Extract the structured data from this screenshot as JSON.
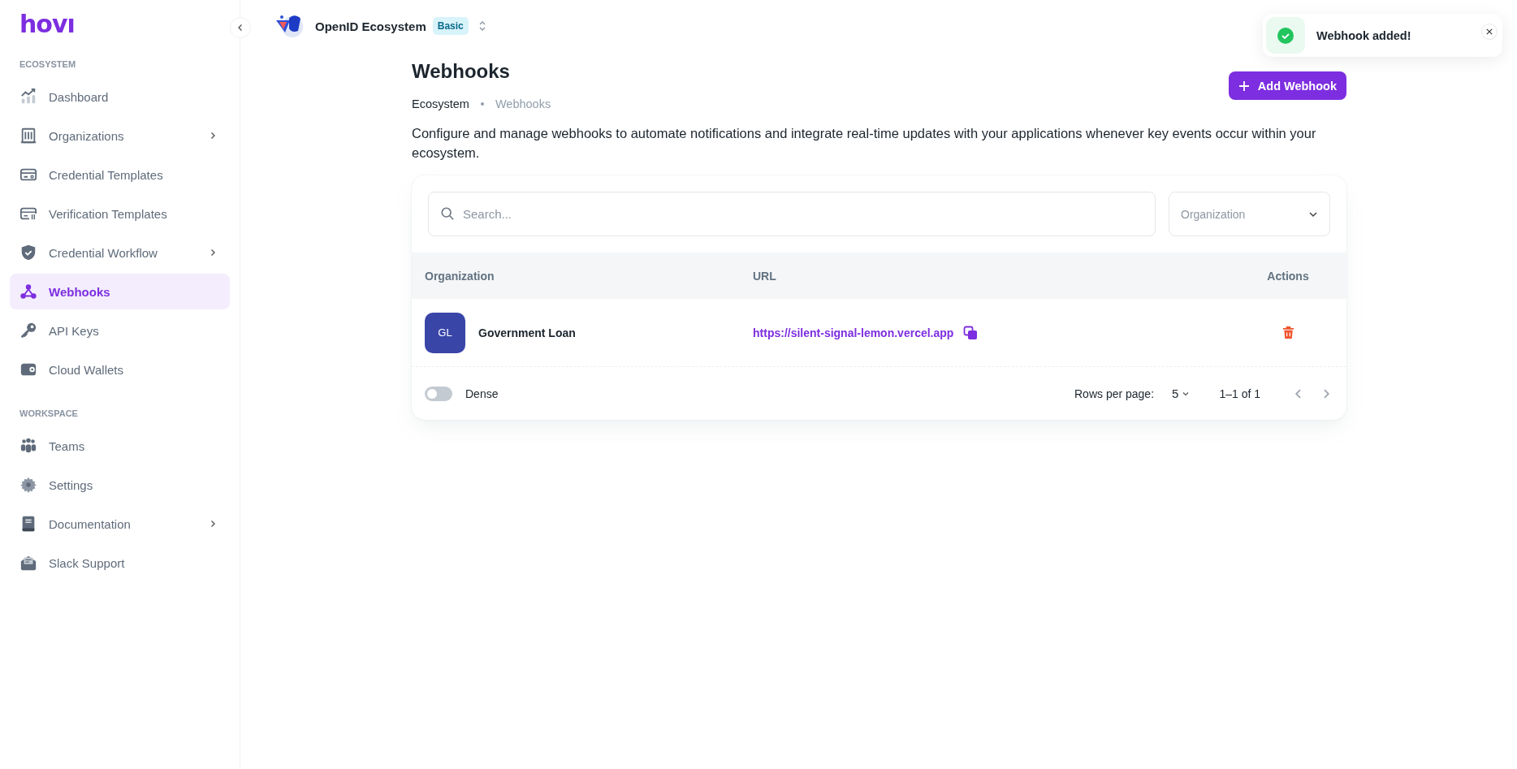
{
  "sidebar": {
    "logo": "hovı",
    "sections": [
      {
        "title": "ECOSYSTEM",
        "items": [
          {
            "label": "Dashboard",
            "selected": false,
            "has_submenu": false
          },
          {
            "label": "Organizations",
            "selected": false,
            "has_submenu": true
          },
          {
            "label": "Credential Templates",
            "selected": false,
            "has_submenu": false
          },
          {
            "label": "Verification Templates",
            "selected": false,
            "has_submenu": false
          },
          {
            "label": "Credential Workflow",
            "selected": false,
            "has_submenu": true
          },
          {
            "label": "Webhooks",
            "selected": true,
            "has_submenu": false
          },
          {
            "label": "API Keys",
            "selected": false,
            "has_submenu": false
          },
          {
            "label": "Cloud Wallets",
            "selected": false,
            "has_submenu": false
          }
        ]
      },
      {
        "title": "WORKSPACE",
        "items": [
          {
            "label": "Teams",
            "selected": false,
            "has_submenu": false
          },
          {
            "label": "Settings",
            "selected": false,
            "has_submenu": false
          },
          {
            "label": "Documentation",
            "selected": false,
            "has_submenu": true
          },
          {
            "label": "Slack Support",
            "selected": false,
            "has_submenu": false
          }
        ]
      }
    ]
  },
  "header": {
    "ecosystem": "OpenID Ecosystem",
    "plan_badge": "Basic"
  },
  "page": {
    "title": "Webhooks",
    "breadcrumbs": [
      "Ecosystem",
      "Webhooks"
    ],
    "description": "Configure and manage webhooks to automate notifications and integrate real-time updates with your applications whenever key events occur within your ecosystem.",
    "add_button": "Add Webhook"
  },
  "filters": {
    "search_placeholder": "Search...",
    "organization_placeholder": "Organization"
  },
  "table": {
    "columns": [
      "Organization",
      "URL",
      "Actions"
    ],
    "rows": [
      {
        "initials": "GL",
        "organization": "Government Loan",
        "url": "https://silent-signal-lemon.vercel.app"
      }
    ]
  },
  "footer": {
    "dense_label": "Dense",
    "dense": false,
    "rows_per_page_label": "Rows per page:",
    "rows_per_page": "5",
    "range": "1–1 of 1"
  },
  "toast": {
    "message": "Webhook added!"
  }
}
